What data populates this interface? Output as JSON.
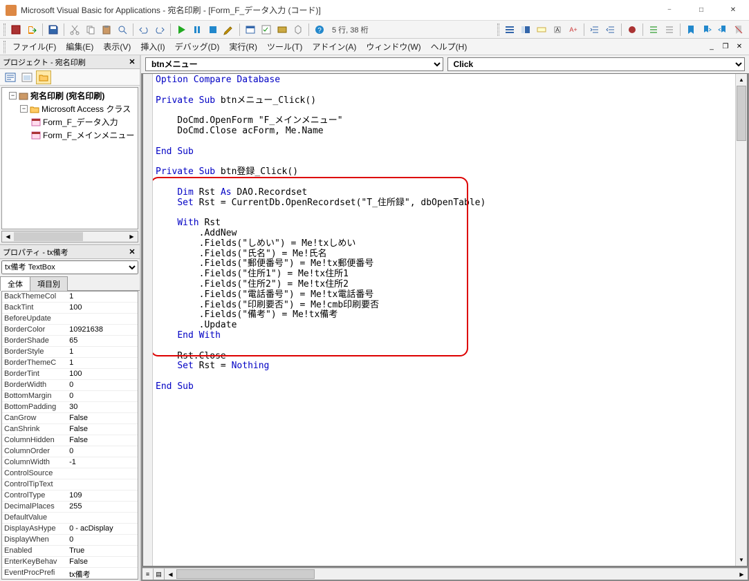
{
  "title": "Microsoft Visual Basic for Applications - 宛名印刷 - [Form_F_データ入力 (コード)]",
  "cursor_pos": "5 行, 38 桁",
  "menu": {
    "file": "ファイル(F)",
    "edit": "編集(E)",
    "view": "表示(V)",
    "insert": "挿入(I)",
    "debug": "デバッグ(D)",
    "run": "実行(R)",
    "tools": "ツール(T)",
    "addins": "アドイン(A)",
    "window": "ウィンドウ(W)",
    "help": "ヘルプ(H)"
  },
  "project_panel": {
    "title": "プロジェクト - 宛名印刷",
    "root": "宛名印刷 (宛名印刷)",
    "folder": "Microsoft Access クラス",
    "items": [
      "Form_F_データ入力",
      "Form_F_メインメニュー"
    ]
  },
  "props_panel": {
    "title": "プロパティ - tx備考",
    "selector": "tx備考 TextBox",
    "tab_all": "全体",
    "tab_cat": "項目別",
    "rows": [
      {
        "n": "BackThemeCol",
        "v": "1"
      },
      {
        "n": "BackTint",
        "v": "100"
      },
      {
        "n": "BeforeUpdate",
        "v": ""
      },
      {
        "n": "BorderColor",
        "v": "10921638"
      },
      {
        "n": "BorderShade",
        "v": "65"
      },
      {
        "n": "BorderStyle",
        "v": "1"
      },
      {
        "n": "BorderThemeC",
        "v": "1"
      },
      {
        "n": "BorderTint",
        "v": "100"
      },
      {
        "n": "BorderWidth",
        "v": "0"
      },
      {
        "n": "BottomMargin",
        "v": "0"
      },
      {
        "n": "BottomPadding",
        "v": "30"
      },
      {
        "n": "CanGrow",
        "v": "False"
      },
      {
        "n": "CanShrink",
        "v": "False"
      },
      {
        "n": "ColumnHidden",
        "v": "False"
      },
      {
        "n": "ColumnOrder",
        "v": "0"
      },
      {
        "n": "ColumnWidth",
        "v": "-1"
      },
      {
        "n": "ControlSource",
        "v": ""
      },
      {
        "n": "ControlTipText",
        "v": ""
      },
      {
        "n": "ControlType",
        "v": "109"
      },
      {
        "n": "DecimalPlaces",
        "v": "255"
      },
      {
        "n": "DefaultValue",
        "v": ""
      },
      {
        "n": "DisplayAsHype",
        "v": "0 - acDisplay"
      },
      {
        "n": "DisplayWhen",
        "v": "0"
      },
      {
        "n": "Enabled",
        "v": "True"
      },
      {
        "n": "EnterKeyBehav",
        "v": "False"
      },
      {
        "n": "EventProcPrefi",
        "v": "tx備考"
      }
    ]
  },
  "code_dd": {
    "object": "btnメニュー",
    "proc": "Click"
  },
  "code_lines": [
    {
      "indent": 0,
      "t": "Option Compare Database",
      "kw": [
        "Option",
        "Compare",
        "Database"
      ]
    },
    {
      "indent": 0,
      "t": ""
    },
    {
      "indent": 0,
      "t": "Private Sub btnメニュー_Click()",
      "kw": [
        "Private",
        "Sub"
      ]
    },
    {
      "indent": 0,
      "t": ""
    },
    {
      "indent": 1,
      "t": "DoCmd.OpenForm \"F_メインメニュー\""
    },
    {
      "indent": 1,
      "t": "DoCmd.Close acForm, Me.Name"
    },
    {
      "indent": 0,
      "t": ""
    },
    {
      "indent": 0,
      "t": "End Sub",
      "kw": [
        "End",
        "Sub"
      ]
    },
    {
      "indent": 0,
      "t": ""
    },
    {
      "indent": 0,
      "t": "Private Sub btn登録_Click()",
      "kw": [
        "Private",
        "Sub"
      ]
    },
    {
      "indent": 0,
      "t": ""
    },
    {
      "indent": 1,
      "t": "Dim Rst As DAO.Recordset",
      "kw": [
        "Dim",
        "As"
      ]
    },
    {
      "indent": 1,
      "t": "Set Rst = CurrentDb.OpenRecordset(\"T_住所録\", dbOpenTable)",
      "kw": [
        "Set"
      ]
    },
    {
      "indent": 0,
      "t": ""
    },
    {
      "indent": 1,
      "t": "With Rst",
      "kw": [
        "With"
      ]
    },
    {
      "indent": 2,
      "t": ".AddNew"
    },
    {
      "indent": 2,
      "t": ".Fields(\"しめい\") = Me!txしめい"
    },
    {
      "indent": 2,
      "t": ".Fields(\"氏名\") = Me!氏名"
    },
    {
      "indent": 2,
      "t": ".Fields(\"郵便番号\") = Me!tx郵便番号"
    },
    {
      "indent": 2,
      "t": ".Fields(\"住所1\") = Me!tx住所1"
    },
    {
      "indent": 2,
      "t": ".Fields(\"住所2\") = Me!tx住所2"
    },
    {
      "indent": 2,
      "t": ".Fields(\"電話番号\") = Me!tx電話番号"
    },
    {
      "indent": 2,
      "t": ".Fields(\"印刷要否\") = Me!cmb印刷要否"
    },
    {
      "indent": 2,
      "t": ".Fields(\"備考\") = Me!tx備考"
    },
    {
      "indent": 2,
      "t": ".Update"
    },
    {
      "indent": 1,
      "t": "End With",
      "kw": [
        "End",
        "With"
      ]
    },
    {
      "indent": 0,
      "t": ""
    },
    {
      "indent": 1,
      "t": "Rst.Close"
    },
    {
      "indent": 1,
      "t": "Set Rst = Nothing",
      "kw": [
        "Set",
        "Nothing"
      ]
    },
    {
      "indent": 0,
      "t": ""
    },
    {
      "indent": 0,
      "t": "End Sub",
      "kw": [
        "End",
        "Sub"
      ]
    }
  ]
}
